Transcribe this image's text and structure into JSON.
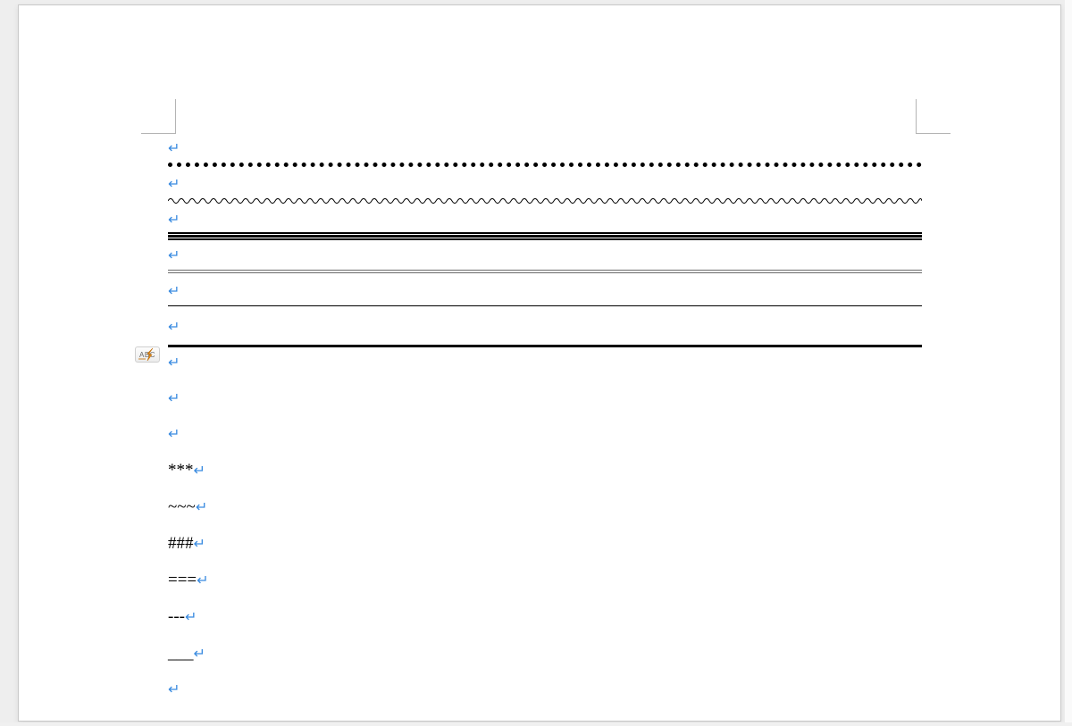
{
  "app": "word-processor-document-area",
  "colors": {
    "paragraph_mark": "#3a8be0",
    "page_bg": "#ffffff",
    "canvas_bg": "#eeeeee"
  },
  "autocorrect_button": {
    "label": "ABC",
    "tooltip": "AutoCorrect Options"
  },
  "paragraphs": [
    {
      "kind": "empty",
      "text": ""
    },
    {
      "kind": "rule",
      "style": "dotted"
    },
    {
      "kind": "empty",
      "text": ""
    },
    {
      "kind": "rule",
      "style": "wave"
    },
    {
      "kind": "empty",
      "text": ""
    },
    {
      "kind": "rule",
      "style": "triple"
    },
    {
      "kind": "empty",
      "text": ""
    },
    {
      "kind": "rule",
      "style": "double-thin"
    },
    {
      "kind": "empty",
      "text": ""
    },
    {
      "kind": "rule",
      "style": "thin"
    },
    {
      "kind": "empty",
      "text": ""
    },
    {
      "kind": "rule",
      "style": "thick"
    },
    {
      "kind": "empty",
      "text": ""
    },
    {
      "kind": "empty",
      "text": ""
    },
    {
      "kind": "empty",
      "text": ""
    },
    {
      "kind": "text",
      "text": "***"
    },
    {
      "kind": "text",
      "text": "~~~"
    },
    {
      "kind": "text",
      "text": "###"
    },
    {
      "kind": "text",
      "text": "==="
    },
    {
      "kind": "text",
      "text": "---"
    },
    {
      "kind": "text",
      "text": "___"
    },
    {
      "kind": "empty",
      "text": ""
    }
  ],
  "pilcrow_glyph": "↵"
}
